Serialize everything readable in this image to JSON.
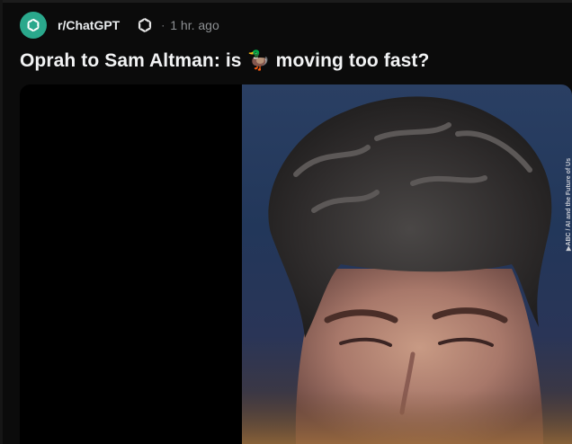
{
  "post": {
    "subreddit": "r/ChatGPT",
    "separator": "·",
    "time": "1 hr. ago",
    "title_before": "Oprah to Sam Altman: is ",
    "title_emoji": "🦆",
    "title_after": " moving too fast?"
  },
  "media": {
    "watermark": "▶ABC / AI and the Future of Us",
    "accent_bg": "#22375a"
  },
  "icons": {
    "subreddit": "openai-logo-icon",
    "flair": "openai-logo-icon"
  }
}
